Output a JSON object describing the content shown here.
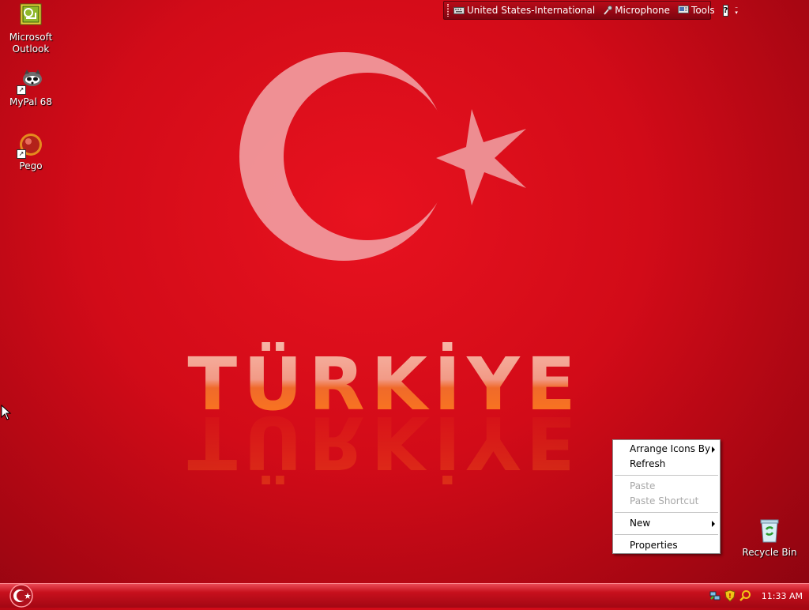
{
  "desktop": {
    "icons": [
      {
        "label_line1": "Microsoft",
        "label_line2": "Outlook",
        "icon": "outlook-icon"
      },
      {
        "label": "MyPal 68",
        "icon": "mypal-icon"
      },
      {
        "label": "Pego",
        "icon": "pego-icon"
      },
      {
        "label": "Recycle Bin",
        "icon": "recycle-bin-icon"
      }
    ],
    "wallpaper_text": "TÜRKİYE"
  },
  "langbar": {
    "language": "United States-International",
    "microphone": "Microphone",
    "tools": "Tools",
    "help": "?"
  },
  "context_menu": {
    "items": [
      {
        "label": "Arrange Icons By",
        "submenu": true,
        "enabled": true
      },
      {
        "label": "Refresh",
        "enabled": true
      },
      {
        "label": "Paste",
        "enabled": false
      },
      {
        "label": "Paste Shortcut",
        "enabled": false
      },
      {
        "label": "New",
        "submenu": true,
        "enabled": true
      },
      {
        "label": "Properties",
        "enabled": true
      }
    ]
  },
  "taskbar": {
    "clock": "11:33 AM"
  },
  "colors": {
    "background": "#d20b18",
    "taskbar": "#c8101d"
  }
}
